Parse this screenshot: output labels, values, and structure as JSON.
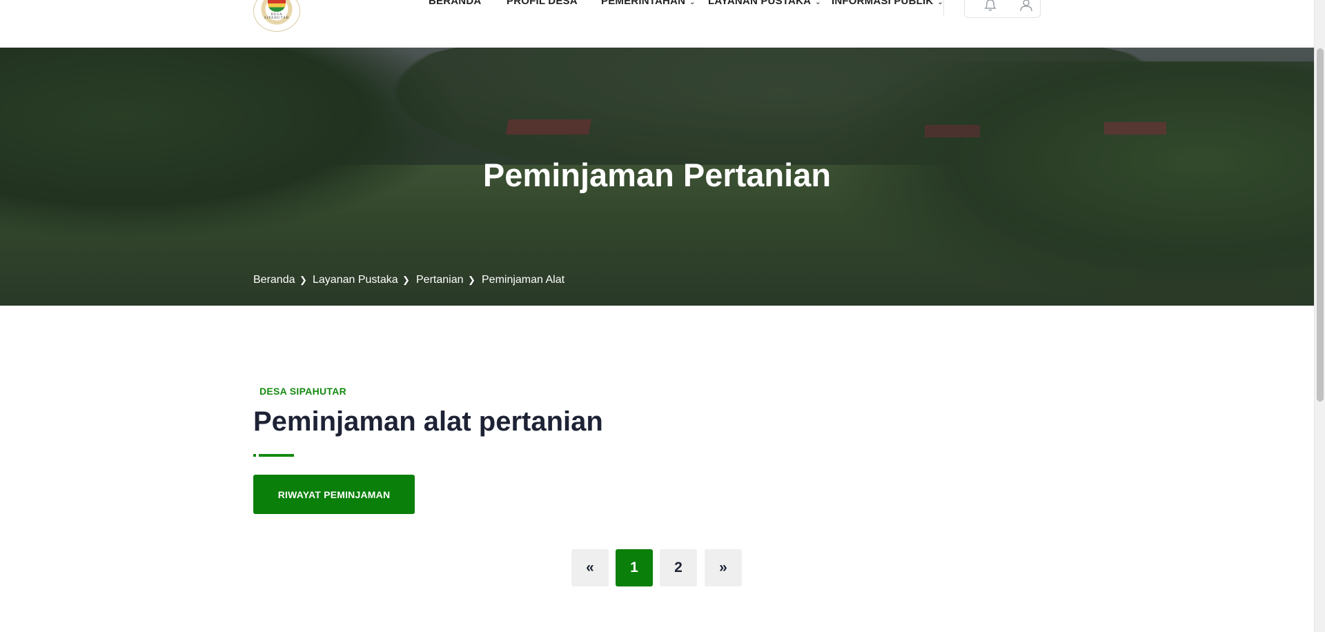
{
  "header": {
    "logo_text": "DESA SIPAHUTAR",
    "nav": [
      {
        "label": "BERANDA",
        "has_dropdown": false
      },
      {
        "label": "PROFIL DESA",
        "has_dropdown": false
      },
      {
        "label": "PEMERINTAHAN",
        "has_dropdown": true
      },
      {
        "label": "LAYANAN PUSTAKA",
        "has_dropdown": true
      },
      {
        "label": "INFORMASI PUBLIK",
        "has_dropdown": true
      }
    ],
    "icons": [
      "bell-icon",
      "user-icon"
    ]
  },
  "hero": {
    "title": "Peminjaman Pertanian",
    "breadcrumb": [
      "Beranda",
      "Layanan Pustaka",
      "Pertanian",
      "Peminjaman Alat"
    ]
  },
  "section": {
    "eyebrow": "DESA SIPAHUTAR",
    "title": "Peminjaman alat pertanian",
    "history_button": "RIWAYAT PEMINJAMAN"
  },
  "pagination": {
    "prev": "«",
    "pages": [
      "1",
      "2"
    ],
    "current": "1",
    "next": "»"
  },
  "colors": {
    "accent": "#0a7f0a",
    "eyebrow": "#138a0f",
    "text_dark": "#1e2235",
    "pager_bg": "#efefef"
  }
}
